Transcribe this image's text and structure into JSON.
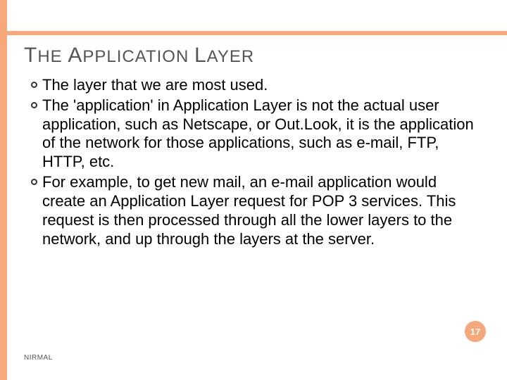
{
  "colors": {
    "accent": "#f6a87a",
    "title": "#555555",
    "body": "#000000",
    "badge_text": "#ffffff"
  },
  "title": {
    "word1_first": "T",
    "word1_rest": "HE",
    "word2_first": "A",
    "word2_rest": "PPLICATION",
    "word3_first": "L",
    "word3_rest": "AYER"
  },
  "bullets": [
    "The layer that we are most used.",
    "The 'application' in Application Layer is not the actual user application, such as Netscape, or Out.Look, it is the application of the network for those applications, such as e-mail, FTP, HTTP, etc.",
    "For example, to get new mail, an e-mail application would create an Application Layer request for POP 3 services. This request is then processed through all the lower layers to the network, and up through the layers at the server."
  ],
  "page_number": "17",
  "author": "NIRMAL"
}
